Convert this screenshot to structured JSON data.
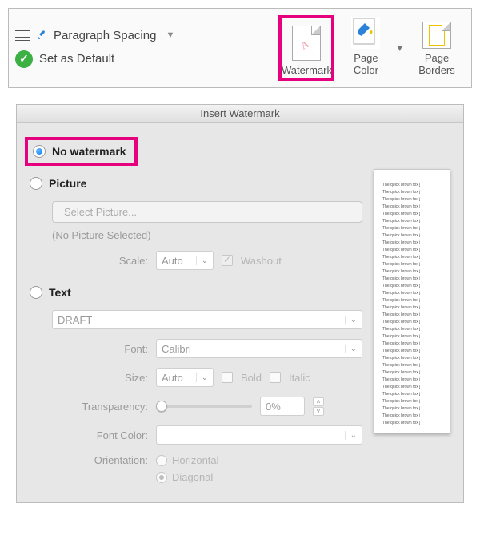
{
  "ribbon": {
    "paragraph_spacing": "Paragraph Spacing",
    "set_default": "Set as Default",
    "watermark": "Watermark",
    "page_color": "Page Color",
    "page_borders": "Page Borders"
  },
  "dialog": {
    "title": "Insert Watermark",
    "no_watermark": "No watermark",
    "picture": "Picture",
    "select_picture": "Select Picture...",
    "no_picture_selected": "(No Picture Selected)",
    "scale_label": "Scale:",
    "scale_value": "Auto",
    "washout": "Washout",
    "text": "Text",
    "text_value": "DRAFT",
    "font_label": "Font:",
    "font_value": "Calibri",
    "size_label": "Size:",
    "size_value": "Auto",
    "bold": "Bold",
    "italic": "Italic",
    "transparency_label": "Transparency:",
    "transparency_value": "0%",
    "font_color_label": "Font Color:",
    "orientation_label": "Orientation:",
    "horizontal": "Horizontal",
    "diagonal": "Diagonal",
    "preview_line": "The quick brown fox j"
  }
}
